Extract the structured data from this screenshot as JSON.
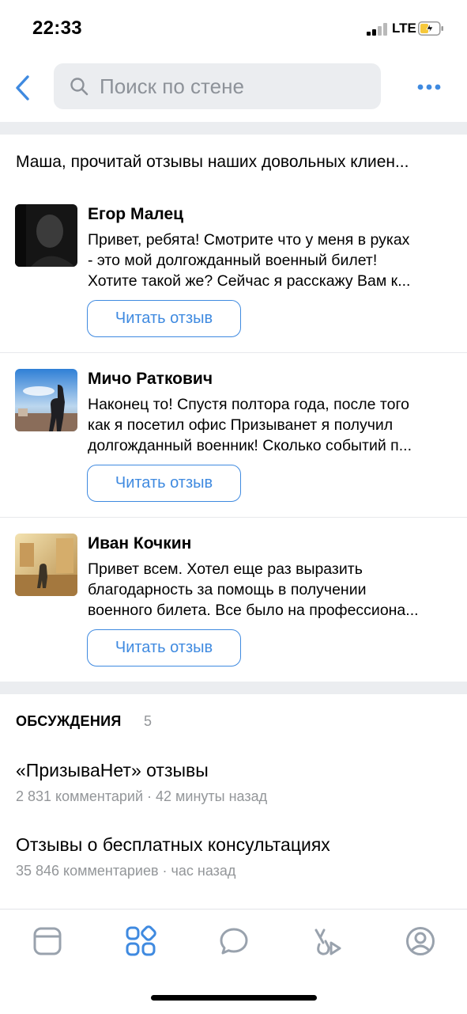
{
  "status_bar": {
    "time": "22:33",
    "network": "LTE"
  },
  "search": {
    "placeholder": "Поиск по стене"
  },
  "pinned_post": {
    "text": "Маша, прочитай отзывы наших довольных клиен..."
  },
  "reviews": [
    {
      "name": "Егор Малец",
      "lines": [
        "Привет, ребята! Смотрите что у меня в руках",
        "- это мой долгожданный военный билет!",
        "Хотите такой же?    Сейчас я расскажу Вам к..."
      ],
      "button": "Читать отзыв"
    },
    {
      "name": "Мичо Раткович",
      "lines": [
        "Наконец то! Спустя полтора года, после того",
        "как я посетил офис Призыванет я получил",
        "долгожданный военник! Сколько событий п..."
      ],
      "button": "Читать отзыв"
    },
    {
      "name": "Иван Кочкин",
      "lines": [
        "Привет всем. Хотел еще раз выразить",
        "благодарность за помощь в получении",
        "военного билета. Все было на профессиона..."
      ],
      "button": "Читать отзыв"
    }
  ],
  "discussions": {
    "title": "ОБСУЖДЕНИЯ",
    "count": "5",
    "topics": [
      {
        "title": "«ПризываНет» отзывы",
        "meta": "2 831 комментарий · 42 минуты назад"
      },
      {
        "title": "Отзывы о бесплатных консультациях",
        "meta": "35 846 комментариев · час назад"
      }
    ]
  },
  "tab_bar": {
    "tabs": [
      "news-icon",
      "services-icon",
      "messages-icon",
      "clips-icon",
      "profile-icon"
    ],
    "active_index": 1
  },
  "colors": {
    "accent": "#3f8ae0",
    "inactive_icon": "#99a2ad",
    "secondary_text": "#939699",
    "band": "#ebedf0"
  }
}
